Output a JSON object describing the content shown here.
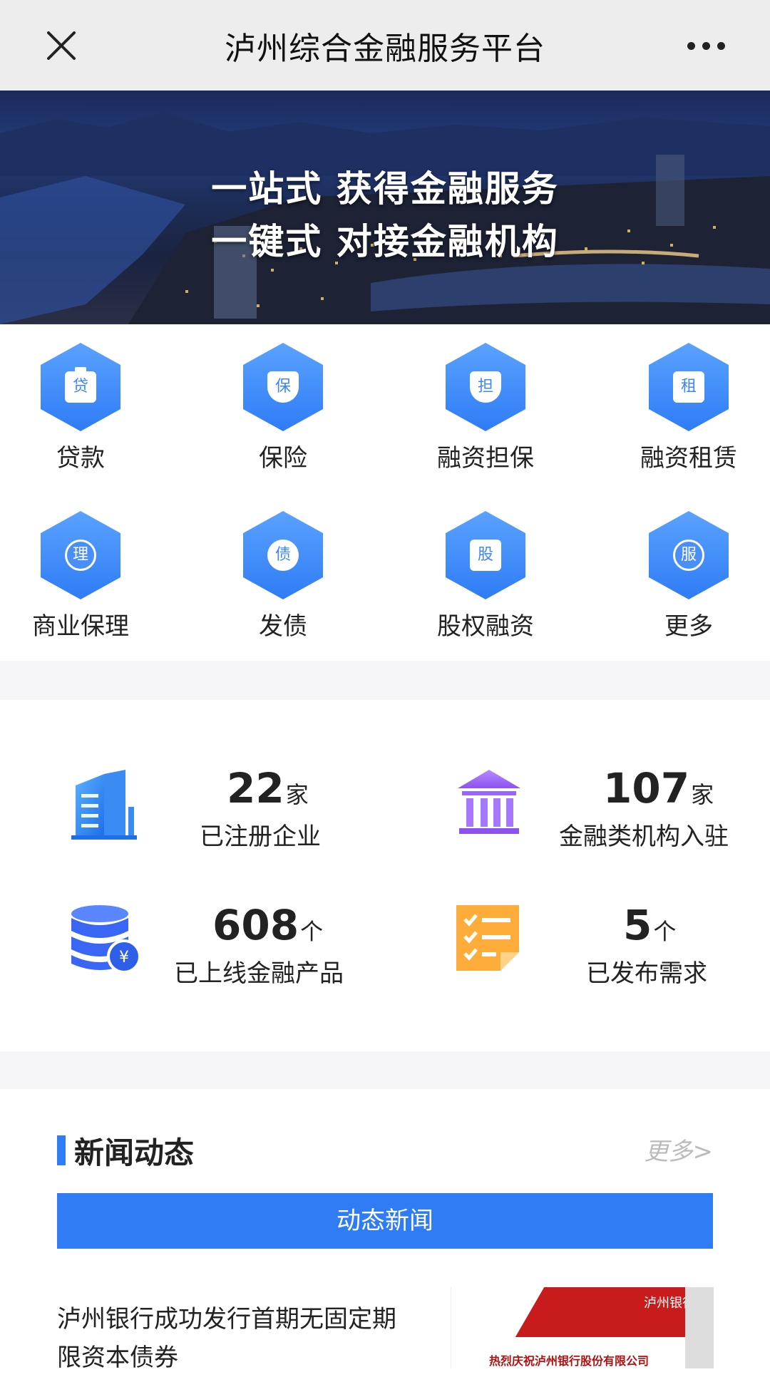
{
  "nav": {
    "title": "泸州综合金融服务平台",
    "close_icon": "close-icon",
    "more_icon": "more-dots-icon"
  },
  "banner": {
    "line1": "一站式  获得金融服务",
    "line2": "一键式  对接金融机构"
  },
  "services": [
    {
      "label": "贷款",
      "glyph": "贷",
      "icon": "loan-icon"
    },
    {
      "label": "保险",
      "glyph": "保",
      "icon": "insurance-icon"
    },
    {
      "label": "融资担保",
      "glyph": "担",
      "icon": "guarantee-icon"
    },
    {
      "label": "融资租赁",
      "glyph": "租",
      "icon": "leasing-icon"
    },
    {
      "label": "商业保理",
      "glyph": "理",
      "icon": "factoring-icon"
    },
    {
      "label": "发债",
      "glyph": "债",
      "icon": "bond-icon"
    },
    {
      "label": "股权融资",
      "glyph": "股",
      "icon": "equity-icon"
    },
    {
      "label": "更多",
      "glyph": "服",
      "icon": "more-services-icon"
    }
  ],
  "stats": [
    {
      "value": "22",
      "unit": "家",
      "caption": "已注册企业",
      "icon": "building-icon"
    },
    {
      "value": "107",
      "unit": "家",
      "caption": "金融类机构入驻",
      "icon": "bank-icon"
    },
    {
      "value": "608",
      "unit": "个",
      "caption": "已上线金融产品",
      "icon": "database-yuan-icon"
    },
    {
      "value": "5",
      "unit": "个",
      "caption": "已发布需求",
      "icon": "checklist-icon"
    }
  ],
  "news": {
    "title": "新闻动态",
    "more": "更多>",
    "tab": "动态新闻",
    "item_title": "泸州银行成功发行首期无固定期限资本债券",
    "thumb_logo": "泸州银行",
    "thumb_caption": "热烈庆祝泸州银行股份有限公司"
  },
  "colors": {
    "accent": "#2f7cf5",
    "nav_bg": "#ededed",
    "divider": "#f5f5f7"
  }
}
